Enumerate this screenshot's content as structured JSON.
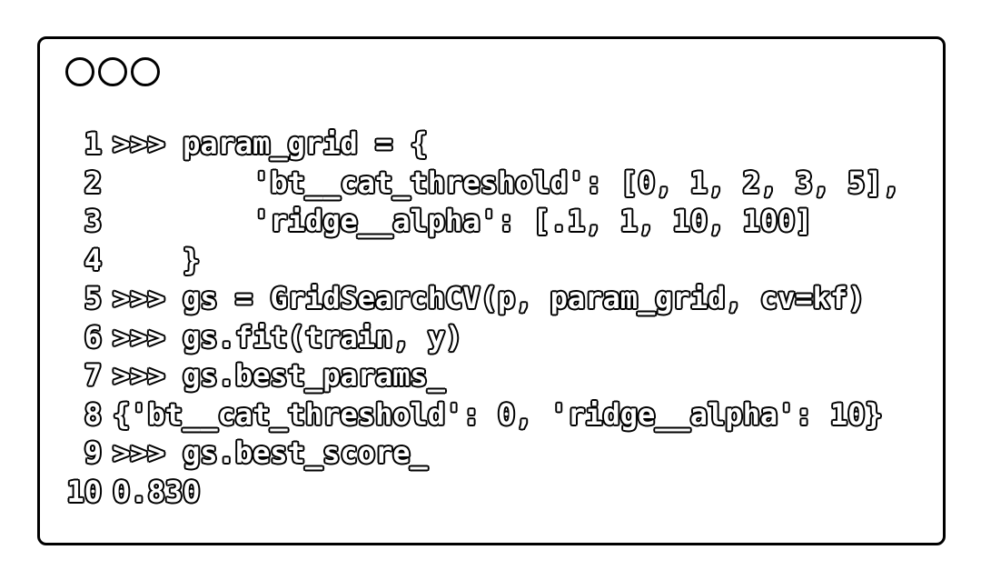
{
  "window": {
    "controls": [
      "circle-1",
      "circle-2",
      "circle-3"
    ],
    "lines": [
      {
        "number": "1",
        "code": ">>> param_grid = {"
      },
      {
        "number": "2",
        "code": "        'bt__cat_threshold': [0, 1, 2, 3, 5],"
      },
      {
        "number": "3",
        "code": "        'ridge__alpha': [.1, 1, 10, 100]"
      },
      {
        "number": "4",
        "code": "    }"
      },
      {
        "number": "5",
        "code": ">>> gs = GridSearchCV(p, param_grid, cv=kf)"
      },
      {
        "number": "6",
        "code": ">>> gs.fit(train, y)"
      },
      {
        "number": "7",
        "code": ">>> gs.best_params_"
      },
      {
        "number": "8",
        "code": "{'bt__cat_threshold': 0, 'ridge__alpha': 10}"
      },
      {
        "number": "9",
        "code": ">>> gs.best_score_"
      },
      {
        "number": "10",
        "code": "0.830"
      }
    ]
  }
}
